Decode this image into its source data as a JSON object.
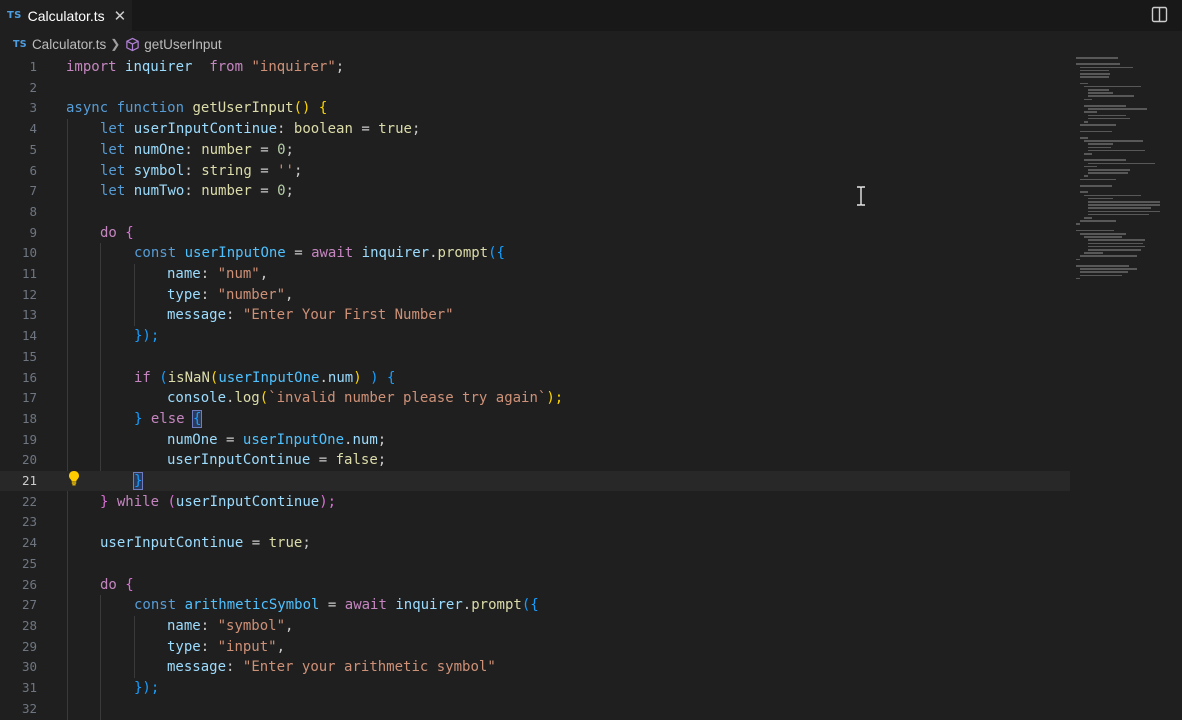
{
  "tab": {
    "badge": "TS",
    "label": "Calculator.ts"
  },
  "breadcrumb": {
    "badge": "TS",
    "file": "Calculator.ts",
    "symbol": "getUserInput"
  },
  "editor": {
    "current_line": 21,
    "line_numbers": [
      "1",
      "2",
      "3",
      "4",
      "5",
      "6",
      "7",
      "8",
      "9",
      "10",
      "11",
      "12",
      "13",
      "14",
      "15",
      "16",
      "17",
      "18",
      "19",
      "20",
      "21",
      "22",
      "23",
      "24",
      "25",
      "26",
      "27",
      "28",
      "29",
      "30",
      "31",
      "32"
    ]
  },
  "code": {
    "l1": {
      "import": "import",
      "inquirer": "inquirer",
      "from": "from",
      "module": "\"inquirer\"",
      "end": ";"
    },
    "l3": {
      "async": "async",
      "function": "function",
      "name": "getUserInput",
      "paren": "()",
      "brace": "{"
    },
    "l4": {
      "let": "let",
      "var": "userInputContinue",
      "colon": ":",
      "type": "boolean",
      "eq": "=",
      "val": "true",
      "end": ";"
    },
    "l5": {
      "let": "let",
      "var": "numOne",
      "colon": ":",
      "type": "number",
      "eq": "=",
      "val": "0",
      "end": ";"
    },
    "l6": {
      "let": "let",
      "var": "symbol",
      "colon": ":",
      "type": "string",
      "eq": "=",
      "val": "''",
      "end": ";"
    },
    "l7": {
      "let": "let",
      "var": "numTwo",
      "colon": ":",
      "type": "number",
      "eq": "=",
      "val": "0",
      "end": ";"
    },
    "l9": {
      "do": "do",
      "brace": "{"
    },
    "l10": {
      "const": "const",
      "var": "userInputOne",
      "eq": "=",
      "await": "await",
      "obj": "inquirer",
      "dot": ".",
      "method": "prompt",
      "open": "({"
    },
    "l11": {
      "key": "name",
      "colon": ":",
      "val": "\"num\"",
      "end": ","
    },
    "l12": {
      "key": "type",
      "colon": ":",
      "val": "\"number\"",
      "end": ","
    },
    "l13": {
      "key": "message",
      "colon": ":",
      "val": "\"Enter Your First Number\""
    },
    "l14": {
      "close": "});"
    },
    "l16": {
      "if": "if",
      "open": "(",
      "fn": "isNaN",
      "p1": "(",
      "obj": "userInputOne",
      "dot": ".",
      "prop": "num",
      "p2": ")",
      "close": ")",
      "brace": "{"
    },
    "l17": {
      "obj": "console",
      "dot": ".",
      "method": "log",
      "open": "(",
      "val": "`invalid number please try again`",
      "close": ");"
    },
    "l18": {
      "close_brace": "}",
      "else": "else",
      "brace": "{"
    },
    "l19": {
      "var": "numOne",
      "eq": "=",
      "obj": "userInputOne",
      "dot": ".",
      "prop": "num",
      "end": ";"
    },
    "l20": {
      "var": "userInputContinue",
      "eq": "=",
      "val": "false",
      "end": ";"
    },
    "l21": {
      "brace": "}"
    },
    "l22": {
      "brace": "}",
      "while": "while",
      "open": "(",
      "var": "userInputContinue",
      "close": ");"
    },
    "l24": {
      "var": "userInputContinue",
      "eq": "=",
      "val": "true",
      "end": ";"
    },
    "l26": {
      "do": "do",
      "brace": "{"
    },
    "l27": {
      "const": "const",
      "var": "arithmeticSymbol",
      "eq": "=",
      "await": "await",
      "obj": "inquirer",
      "dot": ".",
      "method": "prompt",
      "open": "({"
    },
    "l28": {
      "key": "name",
      "colon": ":",
      "val": "\"symbol\"",
      "end": ","
    },
    "l29": {
      "key": "type",
      "colon": ":",
      "val": "\"input\"",
      "end": ","
    },
    "l30": {
      "key": "message",
      "colon": ":",
      "val": "\"Enter your arithmetic symbol\""
    },
    "l31": {
      "close": "});"
    }
  },
  "icons": {
    "close": "close-icon",
    "split": "split-editor-icon",
    "symbol": "method-cube-icon",
    "lightbulb": "lightbulb-icon",
    "cursor": "text-cursor-icon"
  },
  "colors": {
    "background": "#1f1f1f",
    "tabbar": "#181818",
    "keyword": "#c586c0",
    "storage": "#569cd6",
    "function": "#dcdcaa",
    "variable": "#9cdcfe",
    "string": "#ce9178",
    "number": "#b5cea8",
    "bracket": "#ffd700",
    "ts_badge": "#4d9de0"
  }
}
